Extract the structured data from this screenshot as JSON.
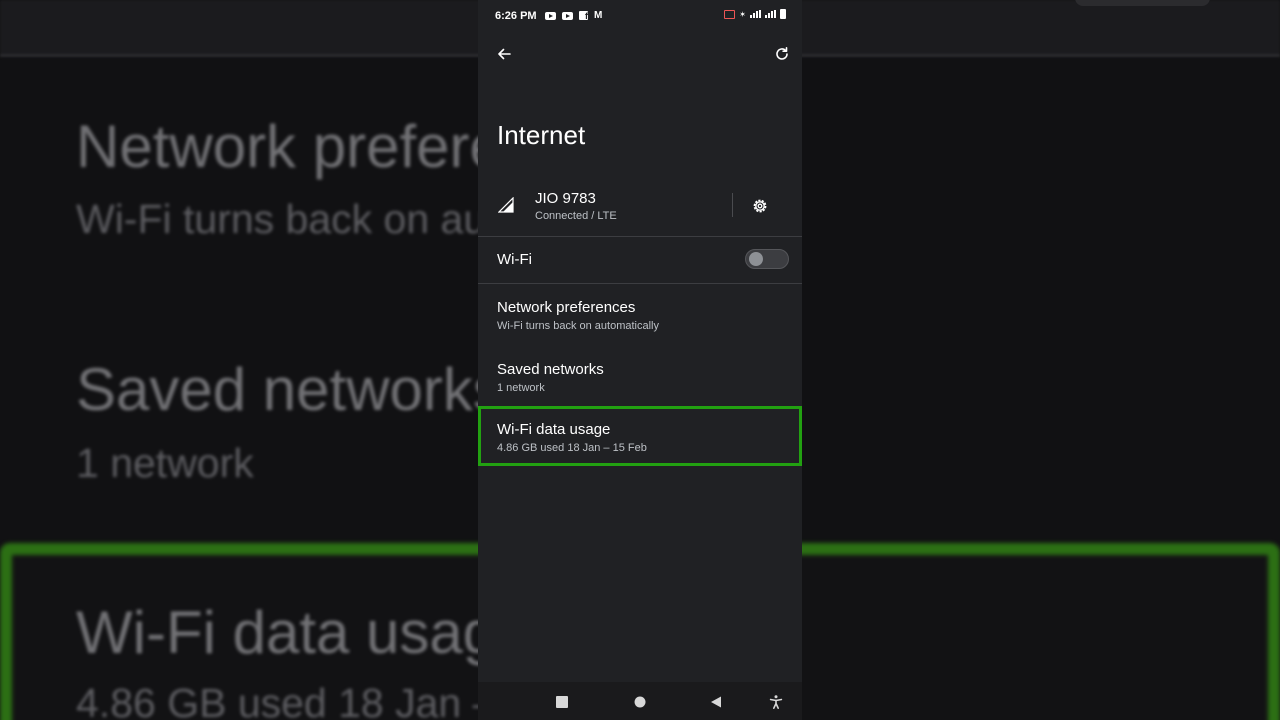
{
  "status_bar": {
    "time": "6:26 PM",
    "left_icons": [
      "youtube-icon",
      "youtube-icon",
      "facebook-icon",
      "gmail-icon"
    ],
    "right_icons": [
      "cast-icon",
      "bluetooth-icon",
      "volte-icon",
      "signal-icon",
      "volte-icon",
      "signal-icon",
      "battery-icon"
    ]
  },
  "app_bar": {
    "back_icon": "arrow-left-icon",
    "refresh_icon": "refresh-icon"
  },
  "page": {
    "title": "Internet"
  },
  "carrier": {
    "name": "JIO 9783",
    "status": "Connected / LTE",
    "signal_icon": "cell-signal-icon",
    "settings_icon": "gear-icon"
  },
  "wifi": {
    "label": "Wi-Fi",
    "enabled": false
  },
  "items": [
    {
      "title": "Network preferences",
      "subtitle": "Wi-Fi turns back on automatically"
    },
    {
      "title": "Saved networks",
      "subtitle": "1 network"
    },
    {
      "title": "Wi-Fi data usage",
      "subtitle": "4.86 GB used 18 Jan – 15 Feb"
    }
  ],
  "nav_bar": {
    "buttons": [
      "recents-icon",
      "home-icon",
      "back-icon",
      "accessibility-icon"
    ]
  },
  "colors": {
    "screen_bg": "#202124",
    "highlight": "#22a111",
    "text_primary": "#ffffff",
    "text_secondary": "#bdc1c6"
  }
}
